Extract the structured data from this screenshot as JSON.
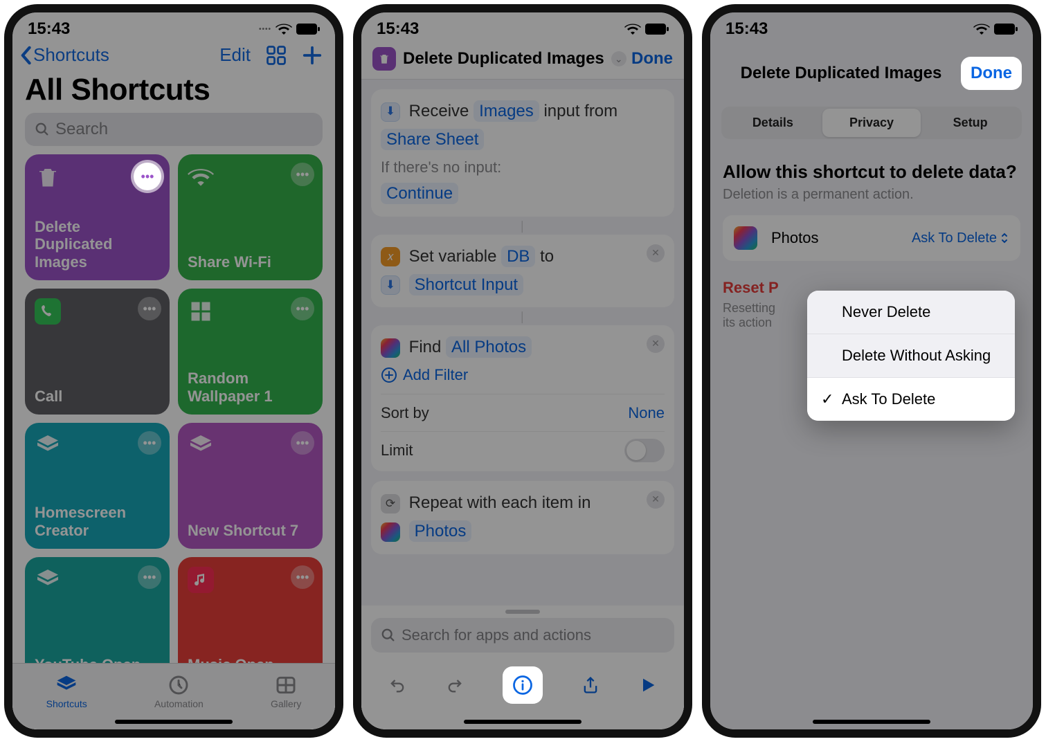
{
  "status": {
    "time": "15:43"
  },
  "screen1": {
    "back": "Shortcuts",
    "edit": "Edit",
    "title": "All Shortcuts",
    "search_placeholder": "Search",
    "tiles": [
      {
        "label": "Delete Duplicated Images"
      },
      {
        "label": "Share Wi-Fi"
      },
      {
        "label": "Call"
      },
      {
        "label": "Random Wallpaper 1"
      },
      {
        "label": "Homescreen Creator"
      },
      {
        "label": "New Shortcut 7"
      },
      {
        "label": "YouTube Open"
      },
      {
        "label": "Music Open"
      }
    ],
    "tabs": {
      "shortcuts": "Shortcuts",
      "automation": "Automation",
      "gallery": "Gallery"
    }
  },
  "screen2": {
    "title": "Delete Duplicated Images",
    "done": "Done",
    "receive": {
      "pre": "Receive",
      "type": "Images",
      "post": "input from",
      "source": "Share Sheet"
    },
    "noinput_label": "If there's no input:",
    "noinput_value": "Continue",
    "setvar": {
      "pre": "Set variable",
      "name": "DB",
      "mid": "to",
      "value": "Shortcut Input"
    },
    "find": {
      "pre": "Find",
      "value": "All Photos",
      "add": "Add Filter",
      "sort_label": "Sort by",
      "sort_value": "None",
      "limit_label": "Limit"
    },
    "repeat": {
      "pre": "Repeat with each item in",
      "value": "Photos"
    },
    "search_placeholder": "Search for apps and actions"
  },
  "screen3": {
    "title": "Delete Duplicated Images",
    "done": "Done",
    "tabs": {
      "details": "Details",
      "privacy": "Privacy",
      "setup": "Setup"
    },
    "heading": "Allow this shortcut to delete data?",
    "sub": "Deletion is a permanent action.",
    "row": {
      "app": "Photos",
      "value": "Ask To Delete"
    },
    "reset": "Reset P",
    "reset_sub": "Resetting\nits action",
    "options": [
      "Never Delete",
      "Delete Without Asking",
      "Ask To Delete"
    ]
  }
}
